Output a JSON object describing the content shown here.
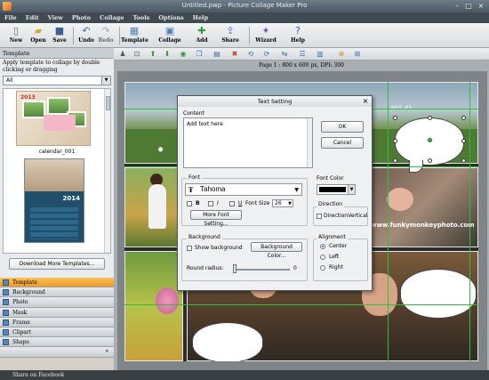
{
  "window": {
    "title": "Untitled.pwp - Picture Collage Maker Pro"
  },
  "menu": [
    "File",
    "Edit",
    "View",
    "Photo",
    "Collage",
    "Tools",
    "Options",
    "Help"
  ],
  "toolbar": [
    {
      "label": "New",
      "icon": "new-file-icon"
    },
    {
      "label": "Open",
      "icon": "open-folder-icon"
    },
    {
      "label": "Save",
      "icon": "save-disk-icon"
    },
    {
      "label": "Undo",
      "icon": "undo-icon"
    },
    {
      "label": "Redo",
      "icon": "redo-icon"
    },
    {
      "label": "Template",
      "icon": "template-icon"
    },
    {
      "label": "Collage",
      "icon": "collage-icon"
    },
    {
      "label": "Add",
      "icon": "add-icon"
    },
    {
      "label": "Share",
      "icon": "share-icon"
    },
    {
      "label": "Wizard",
      "icon": "wizard-icon"
    },
    {
      "label": "Help",
      "icon": "help-icon"
    }
  ],
  "left_panel": {
    "header": "Template",
    "instructions": "Apply template to collage by double clicking or dragging",
    "filter_value": "All",
    "templates": [
      {
        "label": "calendar_001",
        "year": "2013"
      },
      {
        "label": "",
        "year": "2014"
      }
    ],
    "download_button": "Download More Templates..."
  },
  "tabs": [
    "Template",
    "Background",
    "Photo",
    "Mask",
    "Frame",
    "Clipart",
    "Shape"
  ],
  "tabs_active": "Template",
  "status": {
    "share": "Share on Facebook"
  },
  "canvas": {
    "page_info": "Page 1 : 800 x 600 px, DPI: 300",
    "coord": "603, 43",
    "watermark": "www.funkymonkeyphoto.com"
  },
  "dialog": {
    "title": "Text Setting",
    "content_label": "Content",
    "content_value": "Add text here",
    "ok": "OK",
    "cancel": "Cancel",
    "font_group": "Font",
    "font_name": "Tahoma",
    "bold_label": "B",
    "italic_label": "I",
    "underline_label": "U",
    "font_size_label": "Font Size",
    "font_size_value": "26",
    "more_font_button": "More Font Setting...",
    "font_color_label": "Font Color",
    "font_color_value": "#000000",
    "direction_label": "Direction",
    "direction_vertical": "DirectionVertical",
    "background_group": "Background",
    "show_background": "Show background",
    "background_color_button": "Background Color...",
    "round_radius_label": "Round radius:",
    "round_radius_value": "0",
    "alignment_group": "Alignment",
    "align_center": "Center",
    "align_left": "Left",
    "align_right": "Right",
    "align_selected": "Center"
  }
}
